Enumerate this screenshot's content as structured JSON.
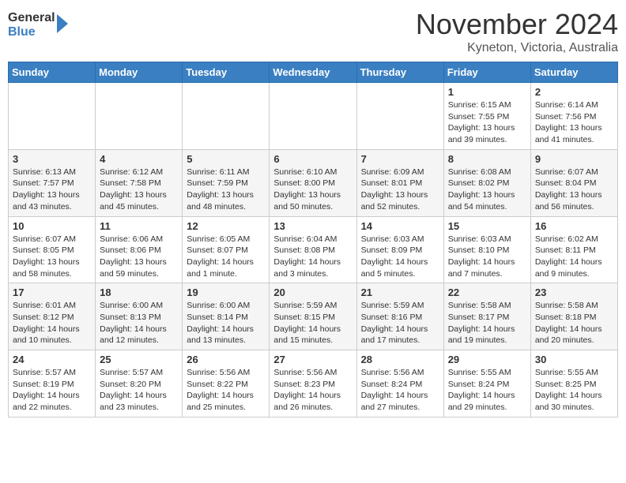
{
  "header": {
    "logo_general": "General",
    "logo_blue": "Blue",
    "month": "November 2024",
    "location": "Kyneton, Victoria, Australia"
  },
  "weekdays": [
    "Sunday",
    "Monday",
    "Tuesday",
    "Wednesday",
    "Thursday",
    "Friday",
    "Saturday"
  ],
  "weeks": [
    [
      {
        "day": "",
        "info": ""
      },
      {
        "day": "",
        "info": ""
      },
      {
        "day": "",
        "info": ""
      },
      {
        "day": "",
        "info": ""
      },
      {
        "day": "",
        "info": ""
      },
      {
        "day": "1",
        "info": "Sunrise: 6:15 AM\nSunset: 7:55 PM\nDaylight: 13 hours\nand 39 minutes."
      },
      {
        "day": "2",
        "info": "Sunrise: 6:14 AM\nSunset: 7:56 PM\nDaylight: 13 hours\nand 41 minutes."
      }
    ],
    [
      {
        "day": "3",
        "info": "Sunrise: 6:13 AM\nSunset: 7:57 PM\nDaylight: 13 hours\nand 43 minutes."
      },
      {
        "day": "4",
        "info": "Sunrise: 6:12 AM\nSunset: 7:58 PM\nDaylight: 13 hours\nand 45 minutes."
      },
      {
        "day": "5",
        "info": "Sunrise: 6:11 AM\nSunset: 7:59 PM\nDaylight: 13 hours\nand 48 minutes."
      },
      {
        "day": "6",
        "info": "Sunrise: 6:10 AM\nSunset: 8:00 PM\nDaylight: 13 hours\nand 50 minutes."
      },
      {
        "day": "7",
        "info": "Sunrise: 6:09 AM\nSunset: 8:01 PM\nDaylight: 13 hours\nand 52 minutes."
      },
      {
        "day": "8",
        "info": "Sunrise: 6:08 AM\nSunset: 8:02 PM\nDaylight: 13 hours\nand 54 minutes."
      },
      {
        "day": "9",
        "info": "Sunrise: 6:07 AM\nSunset: 8:04 PM\nDaylight: 13 hours\nand 56 minutes."
      }
    ],
    [
      {
        "day": "10",
        "info": "Sunrise: 6:07 AM\nSunset: 8:05 PM\nDaylight: 13 hours\nand 58 minutes."
      },
      {
        "day": "11",
        "info": "Sunrise: 6:06 AM\nSunset: 8:06 PM\nDaylight: 13 hours\nand 59 minutes."
      },
      {
        "day": "12",
        "info": "Sunrise: 6:05 AM\nSunset: 8:07 PM\nDaylight: 14 hours\nand 1 minute."
      },
      {
        "day": "13",
        "info": "Sunrise: 6:04 AM\nSunset: 8:08 PM\nDaylight: 14 hours\nand 3 minutes."
      },
      {
        "day": "14",
        "info": "Sunrise: 6:03 AM\nSunset: 8:09 PM\nDaylight: 14 hours\nand 5 minutes."
      },
      {
        "day": "15",
        "info": "Sunrise: 6:03 AM\nSunset: 8:10 PM\nDaylight: 14 hours\nand 7 minutes."
      },
      {
        "day": "16",
        "info": "Sunrise: 6:02 AM\nSunset: 8:11 PM\nDaylight: 14 hours\nand 9 minutes."
      }
    ],
    [
      {
        "day": "17",
        "info": "Sunrise: 6:01 AM\nSunset: 8:12 PM\nDaylight: 14 hours\nand 10 minutes."
      },
      {
        "day": "18",
        "info": "Sunrise: 6:00 AM\nSunset: 8:13 PM\nDaylight: 14 hours\nand 12 minutes."
      },
      {
        "day": "19",
        "info": "Sunrise: 6:00 AM\nSunset: 8:14 PM\nDaylight: 14 hours\nand 13 minutes."
      },
      {
        "day": "20",
        "info": "Sunrise: 5:59 AM\nSunset: 8:15 PM\nDaylight: 14 hours\nand 15 minutes."
      },
      {
        "day": "21",
        "info": "Sunrise: 5:59 AM\nSunset: 8:16 PM\nDaylight: 14 hours\nand 17 minutes."
      },
      {
        "day": "22",
        "info": "Sunrise: 5:58 AM\nSunset: 8:17 PM\nDaylight: 14 hours\nand 19 minutes."
      },
      {
        "day": "23",
        "info": "Sunrise: 5:58 AM\nSunset: 8:18 PM\nDaylight: 14 hours\nand 20 minutes."
      }
    ],
    [
      {
        "day": "24",
        "info": "Sunrise: 5:57 AM\nSunset: 8:19 PM\nDaylight: 14 hours\nand 22 minutes."
      },
      {
        "day": "25",
        "info": "Sunrise: 5:57 AM\nSunset: 8:20 PM\nDaylight: 14 hours\nand 23 minutes."
      },
      {
        "day": "26",
        "info": "Sunrise: 5:56 AM\nSunset: 8:22 PM\nDaylight: 14 hours\nand 25 minutes."
      },
      {
        "day": "27",
        "info": "Sunrise: 5:56 AM\nSunset: 8:23 PM\nDaylight: 14 hours\nand 26 minutes."
      },
      {
        "day": "28",
        "info": "Sunrise: 5:56 AM\nSunset: 8:24 PM\nDaylight: 14 hours\nand 27 minutes."
      },
      {
        "day": "29",
        "info": "Sunrise: 5:55 AM\nSunset: 8:24 PM\nDaylight: 14 hours\nand 29 minutes."
      },
      {
        "day": "30",
        "info": "Sunrise: 5:55 AM\nSunset: 8:25 PM\nDaylight: 14 hours\nand 30 minutes."
      }
    ]
  ]
}
